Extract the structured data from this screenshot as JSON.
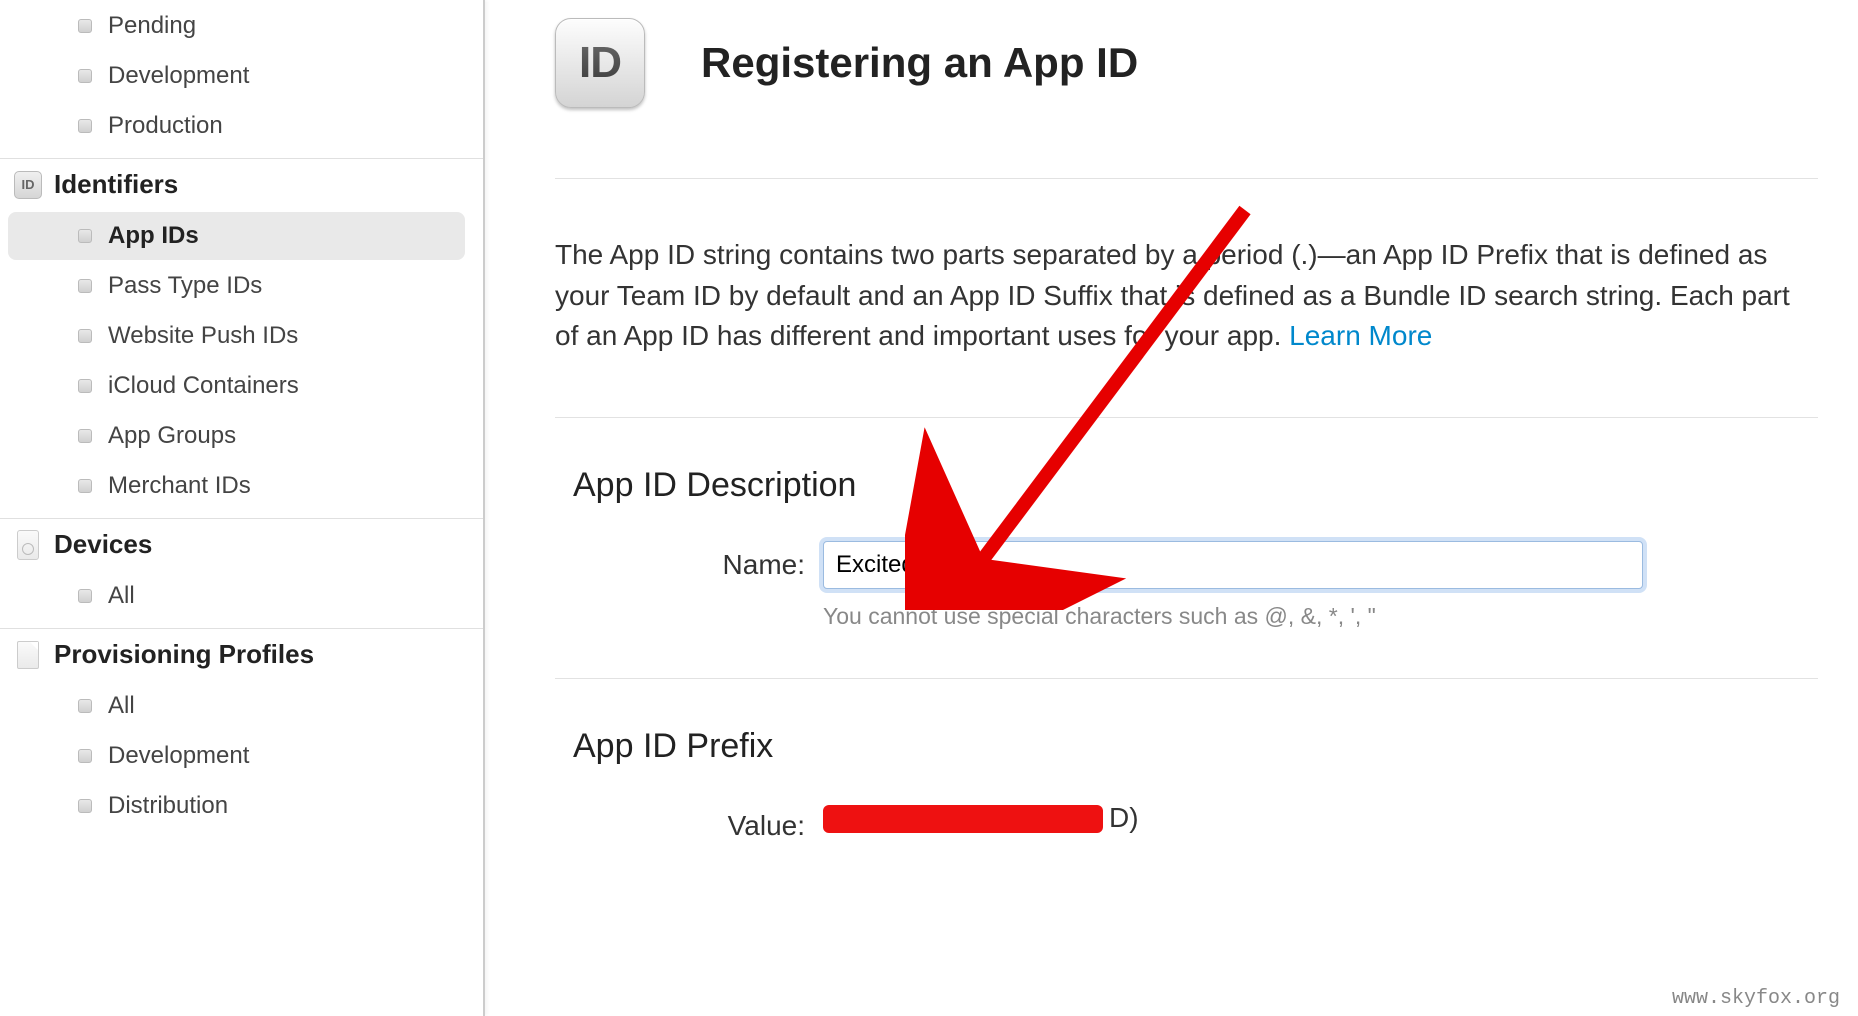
{
  "sidebar": {
    "certificates_items": [
      {
        "label": "Pending"
      },
      {
        "label": "Development"
      },
      {
        "label": "Production"
      }
    ],
    "identifiers_header": "Identifiers",
    "identifiers_items": [
      {
        "label": "App IDs"
      },
      {
        "label": "Pass Type IDs"
      },
      {
        "label": "Website Push IDs"
      },
      {
        "label": "iCloud Containers"
      },
      {
        "label": "App Groups"
      },
      {
        "label": "Merchant IDs"
      }
    ],
    "devices_header": "Devices",
    "devices_items": [
      {
        "label": "All"
      }
    ],
    "profiles_header": "Provisioning Profiles",
    "profiles_items": [
      {
        "label": "All"
      },
      {
        "label": "Development"
      },
      {
        "label": "Distribution"
      }
    ]
  },
  "header": {
    "badge_text": "ID",
    "title": "Registering an App ID"
  },
  "intro": {
    "text": "The App ID string contains two parts separated by a period (.)—an App ID Prefix that is defined as your Team ID by default and an App ID Suffix that is defined as a Bundle ID search string. Each part of an App ID has different and important uses for your app. ",
    "link_text": "Learn More"
  },
  "description_section": {
    "heading": "App ID Description",
    "name_label": "Name:",
    "name_value": "ExcitedApp",
    "name_hint": "You cannot use special characters such as @, &, *, ', \""
  },
  "prefix_section": {
    "heading": "App ID Prefix",
    "value_label": "Value:",
    "value_trail": "D)"
  },
  "watermark": "www.skyfox.org"
}
